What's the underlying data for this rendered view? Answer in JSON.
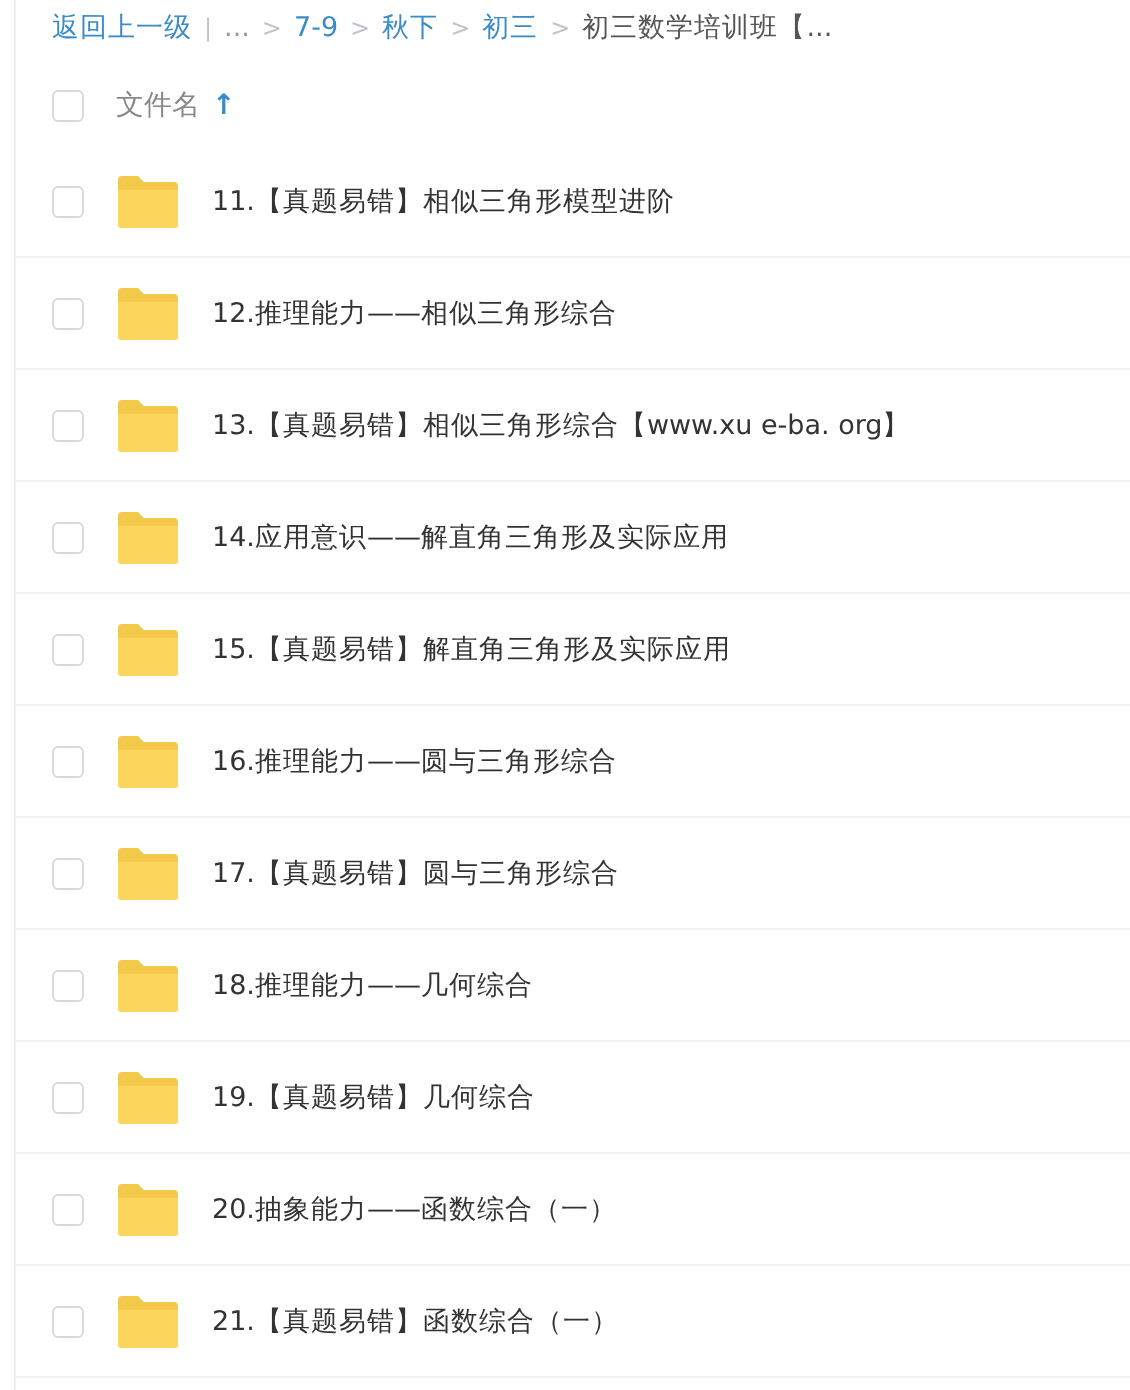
{
  "breadcrumb": {
    "back": "返回上一级",
    "divider": "|",
    "items": [
      {
        "label": "...",
        "kind": "text"
      },
      {
        "label": "7-9",
        "kind": "link"
      },
      {
        "label": "秋下",
        "kind": "link"
      },
      {
        "label": "初三",
        "kind": "link"
      },
      {
        "label": "初三数学培训班【...",
        "kind": "current"
      }
    ],
    "separator": ">"
  },
  "header": {
    "checked": false,
    "column": "文件名",
    "sort_icon": "↑"
  },
  "files": [
    {
      "name": "11.【真题易错】相似三角形模型进阶",
      "checked": false
    },
    {
      "name": "12.推理能力——相似三角形综合",
      "checked": false
    },
    {
      "name": "13.【真题易错】相似三角形综合【www.xu e-ba. org】",
      "checked": false
    },
    {
      "name": "14.应用意识——解直角三角形及实际应用",
      "checked": false
    },
    {
      "name": "15.【真题易错】解直角三角形及实际应用",
      "checked": false
    },
    {
      "name": "16.推理能力——圆与三角形综合",
      "checked": false
    },
    {
      "name": "17.【真题易错】圆与三角形综合",
      "checked": false
    },
    {
      "name": "18.推理能力——几何综合",
      "checked": false
    },
    {
      "name": "19.【真题易错】几何综合",
      "checked": false
    },
    {
      "name": "20.抽象能力——函数综合（一）",
      "checked": false
    },
    {
      "name": "21.【真题易错】函数综合（一）",
      "checked": false
    }
  ]
}
